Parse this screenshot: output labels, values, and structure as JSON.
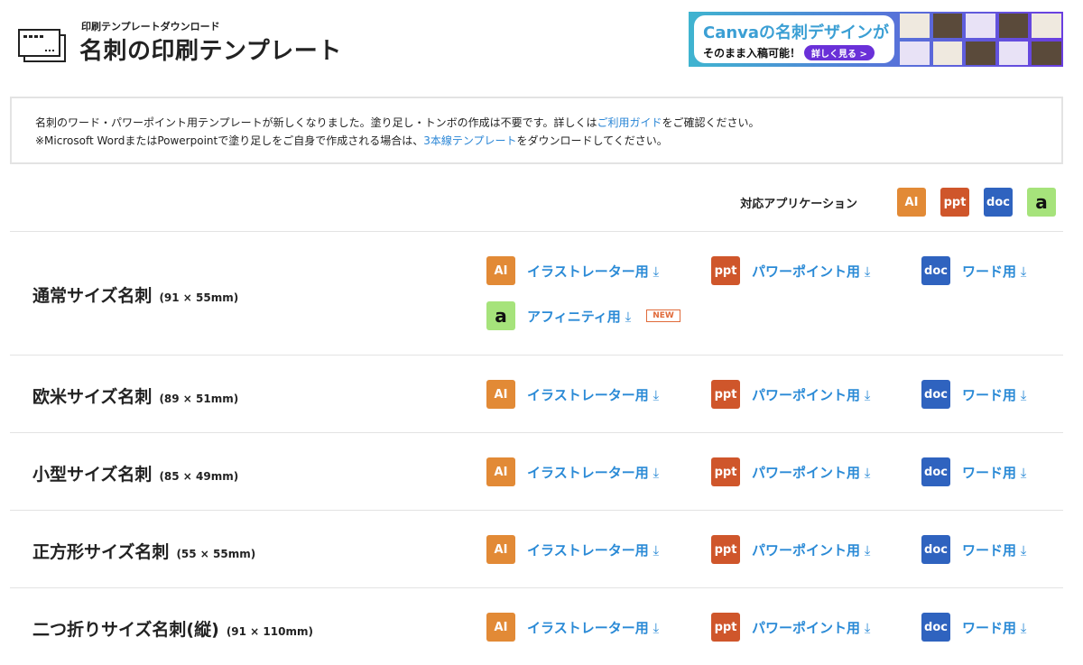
{
  "header": {
    "subtitle": "印刷テンプレートダウンロード",
    "title": "名刺の印刷テンプレート"
  },
  "banner": {
    "line1": "Canvaの名刺デザインが",
    "line2": "そのまま入稿可能！",
    "button": "詳しく見る >"
  },
  "notice": {
    "line1_a": "名刺のワード・パワーポイント用テンプレートが新しくなりました。塗り足し・トンボの作成は不要です。詳しくは",
    "link1": "ご利用ガイド",
    "line1_b": "をご確認ください。",
    "line2_a": "※Microsoft WordまたはPowerpointで塗り足しをご自身で作成される場合は、",
    "link2": "3本線テンプレート",
    "line2_b": "をダウンロードしてください。"
  },
  "apps": {
    "label": "対応アプリケーション",
    "badges": {
      "ai": "AI",
      "ppt": "ppt",
      "doc": "doc",
      "af": "a"
    }
  },
  "links": {
    "ai": "イラストレーター用",
    "ppt": "パワーポイント用",
    "doc": "ワード用",
    "af": "アフィニティ用",
    "new": "NEW"
  },
  "rows": [
    {
      "name": "通常サイズ名刺",
      "size": "(91 × 55mm)"
    },
    {
      "name": "欧米サイズ名刺",
      "size": "(89 × 51mm)"
    },
    {
      "name": "小型サイズ名刺",
      "size": "(85 × 49mm)"
    },
    {
      "name": "正方形サイズ名刺",
      "size": "(55 × 55mm)"
    },
    {
      "name": "二つ折りサイズ名刺(縦)",
      "size": "(91 × 110mm)"
    }
  ]
}
